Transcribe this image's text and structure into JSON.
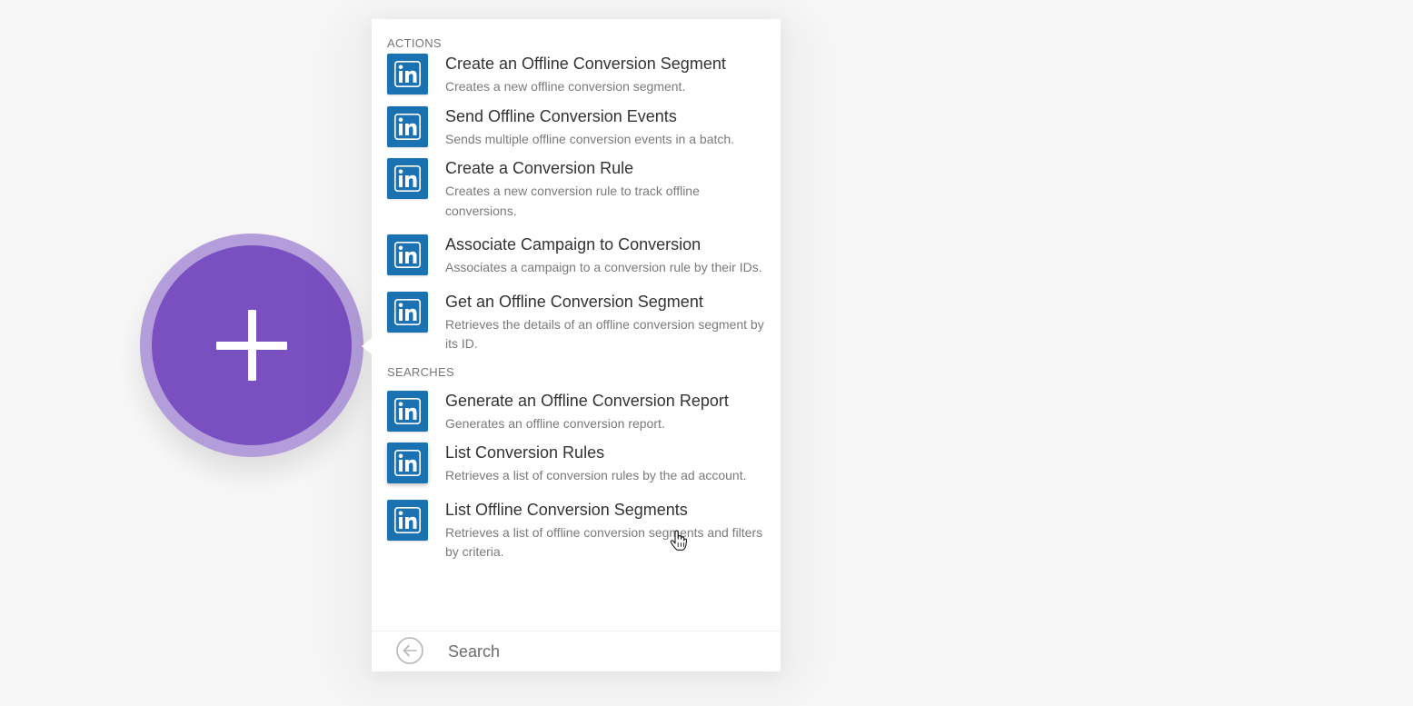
{
  "colors": {
    "module_ring": "#b39ddb",
    "module_fill": "#7a4fc0",
    "linkedin_blue": "#1a72b3"
  },
  "icons": {
    "add": "plus-icon",
    "app": "linkedin-icon",
    "back": "arrow-left-circle-icon",
    "cursor": "hand-pointer-icon"
  },
  "panel": {
    "sections": [
      {
        "title": "ACTIONS",
        "items": [
          {
            "title": "Create an Offline Conversion Segment",
            "description": "Creates a new offline conversion segment."
          },
          {
            "title": "Send Offline Conversion Events",
            "description": "Sends multiple offline conversion events in a batch."
          },
          {
            "title": "Create a Conversion Rule",
            "description": "Creates a new conversion rule to track offline conversions."
          },
          {
            "title": "Associate Campaign to Conversion",
            "description": "Associates a campaign to a conversion rule by their IDs."
          },
          {
            "title": "Get an Offline Conversion Segment",
            "description": "Retrieves the details of an offline conversion segment by its ID."
          }
        ]
      },
      {
        "title": "SEARCHES",
        "items": [
          {
            "title": "Generate an Offline Conversion Report",
            "description": "Generates an offline conversion report."
          },
          {
            "title": "List Conversion Rules",
            "description": "Retrieves a list of conversion rules by the ad account."
          },
          {
            "title": "List Offline Conversion Segments",
            "description": "Retrieves a list of offline conversion segments and filters by criteria."
          }
        ]
      }
    ],
    "search": {
      "placeholder": "Search",
      "value": ""
    }
  }
}
